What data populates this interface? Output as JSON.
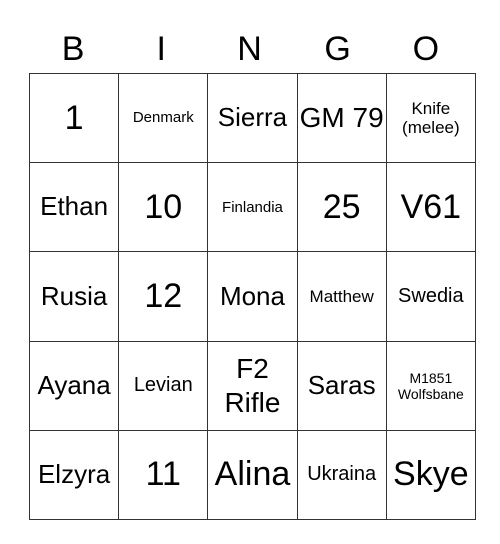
{
  "header": [
    "B",
    "I",
    "N",
    "G",
    "O"
  ],
  "cells": [
    [
      {
        "text": "1",
        "size": "s-xl"
      },
      {
        "text": "Denmark",
        "size": "s-xxs"
      },
      {
        "text": "Sierra",
        "size": "s-m"
      },
      {
        "text": "GM 79",
        "size": "s-l"
      },
      {
        "text": "Knife (melee)",
        "size": "s-xs"
      }
    ],
    [
      {
        "text": "Ethan",
        "size": "s-m"
      },
      {
        "text": "10",
        "size": "s-xl"
      },
      {
        "text": "Finlandia",
        "size": "s-xxs"
      },
      {
        "text": "25",
        "size": "s-xl"
      },
      {
        "text": "V61",
        "size": "s-xl"
      }
    ],
    [
      {
        "text": "Rusia",
        "size": "s-m"
      },
      {
        "text": "12",
        "size": "s-xl"
      },
      {
        "text": "Mona",
        "size": "s-m"
      },
      {
        "text": "Matthew",
        "size": "s-xs"
      },
      {
        "text": "Swedia",
        "size": "s-sm"
      }
    ],
    [
      {
        "text": "Ayana",
        "size": "s-m"
      },
      {
        "text": "Levian",
        "size": "s-sm"
      },
      {
        "text": "F2 Rifle",
        "size": "s-l"
      },
      {
        "text": "Saras",
        "size": "s-m"
      },
      {
        "text": "M1851 Wolfsbane",
        "size": "s-tiny"
      }
    ],
    [
      {
        "text": "Elzyra",
        "size": "s-m"
      },
      {
        "text": "11",
        "size": "s-xl"
      },
      {
        "text": "Alina",
        "size": "s-xl"
      },
      {
        "text": "Ukraina",
        "size": "s-sm"
      },
      {
        "text": "Skye",
        "size": "s-xl"
      }
    ]
  ]
}
